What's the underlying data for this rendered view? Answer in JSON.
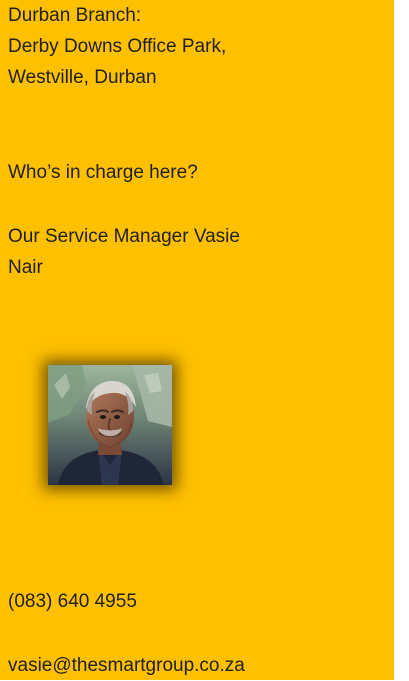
{
  "contact": {
    "branch_label": "Durban Branch:",
    "address_line_1": "Derby Downs Office Park,",
    "address_line_2": "Westville, Durban",
    "question": "Who’s in charge here?",
    "manager_line_1": "Our Service Manager Vasie",
    "manager_line_2": "Nair",
    "phone": "(083) 640 4955",
    "email": "vasie@thesmartgroup.co.za"
  },
  "colors": {
    "panel_background": "#ffc000",
    "text": "#1f1f1f"
  }
}
